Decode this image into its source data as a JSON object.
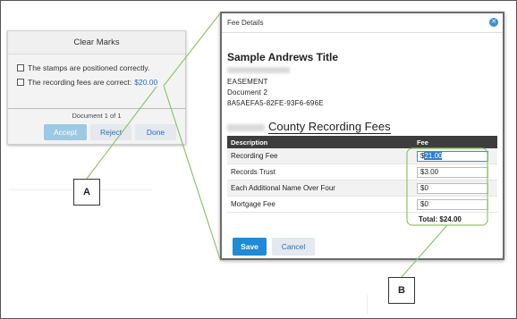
{
  "clear_marks_panel": {
    "title": "Clear Marks",
    "checks": [
      {
        "label": "The stamps are positioned correctly.",
        "link": ""
      },
      {
        "label": "The recording fees are correct:",
        "link": "$20.00"
      }
    ],
    "document_counter": "Document 1 of 1",
    "buttons": {
      "accept": "Accept",
      "reject": "Reject",
      "done": "Done"
    }
  },
  "fee_dialog": {
    "header": "Fee Details",
    "close_icon": "close-icon",
    "title": "Sample Andrews Title",
    "doc_type": "EASEMENT",
    "doc_number": "Document 2",
    "doc_id": "8A5AEFA5-82FE-93F6-696E",
    "county_heading": "County Recording Fees",
    "table": {
      "columns": [
        "Description",
        "Fee"
      ],
      "rows": [
        {
          "description": "Recording Fee",
          "currency": "$",
          "value": "21.00"
        },
        {
          "description": "Records Trust",
          "currency": "$",
          "value": "3.00"
        },
        {
          "description": "Each Additional Name Over Four",
          "currency": "$",
          "value": "0"
        },
        {
          "description": "Mortgage Fee",
          "currency": "$",
          "value": "0"
        }
      ]
    },
    "total": "Total: $24.00",
    "buttons": {
      "save": "Save",
      "cancel": "Cancel"
    }
  },
  "callouts": {
    "a": "A",
    "b": "B"
  },
  "colors": {
    "accent": "#1f8ad6",
    "highlight_box": "#8fc46a",
    "header_bg": "#3d3d3d"
  }
}
